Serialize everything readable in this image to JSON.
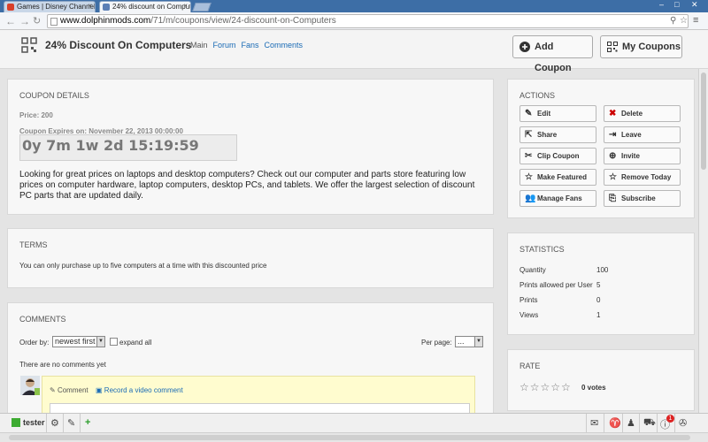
{
  "browser": {
    "tabs": [
      {
        "title": "Games | Disney Channel T",
        "favicon_color": "#d9402a"
      },
      {
        "title": "24% discount on Comput",
        "favicon_color": "#5c7fb5"
      }
    ],
    "window_controls": [
      "–",
      "□",
      "✕"
    ],
    "url_host": "www.dolphinmods.com",
    "url_path": "/71/m/coupons/view/24-discount-on-Computers"
  },
  "header": {
    "title": "24% Discount On Computers",
    "links": [
      "Main",
      "Forum",
      "Fans",
      "Comments"
    ],
    "add_coupon": "Add Coupon",
    "my_coupons": "My Coupons"
  },
  "coupon": {
    "section_title": "COUPON DETAILS",
    "price": "Price: 200",
    "expires": "Coupon Expires on: November 22, 2013 00:00:00",
    "countdown": "0y 7m 1w 2d 15:19:59",
    "description": "Looking for great prices on laptops and desktop computers? Check out our computer and parts store featuring low prices on computer hardware, laptop computers, desktop PCs, and tablets. We offer the largest selection of discount PC parts that are updated daily."
  },
  "terms": {
    "section_title": "TERMS",
    "text": "You can only purchase up to five computers at a time with this discounted price"
  },
  "comments": {
    "section_title": "COMMENTS",
    "order_by_label": "Order by:",
    "order_value": "newest first",
    "expand_all": "expand all",
    "per_page_label": "Per page:",
    "per_page_value": "...",
    "empty_text": "There are no comments yet",
    "comment_tab": "Comment",
    "video_tab": "Record a video comment"
  },
  "actions": {
    "section_title": "ACTIONS",
    "edit": "Edit",
    "delete": "Delete",
    "share": "Share",
    "leave": "Leave",
    "clip": "Clip Coupon",
    "invite": "Invite",
    "make_featured": "Make Featured",
    "remove_today": "Remove Today",
    "manage_fans": "Manage Fans",
    "subscribe": "Subscribe"
  },
  "statistics": {
    "section_title": "STATISTICS",
    "rows": [
      {
        "label": "Quantity",
        "value": "100"
      },
      {
        "label": "Prints allowed per User",
        "value": "5"
      },
      {
        "label": "Prints",
        "value": "0"
      },
      {
        "label": "Views",
        "value": "1"
      }
    ]
  },
  "rate": {
    "section_title": "RATE",
    "stars": "☆☆☆☆☆",
    "votes": "0 votes",
    "rating": 0
  },
  "bottombar": {
    "username": "tester",
    "notification_count": "1"
  }
}
